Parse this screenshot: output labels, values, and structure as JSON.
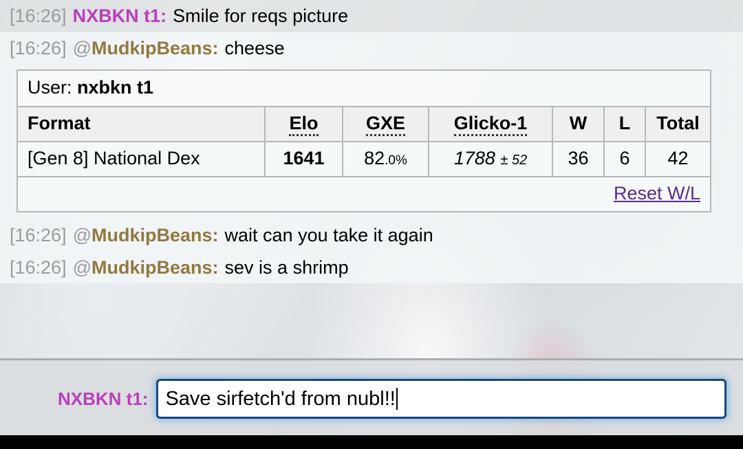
{
  "messages": [
    {
      "timestamp": "[16:26]",
      "at": "",
      "username": "NXBKN t1:",
      "color": "#bc3dbc",
      "text": "Smile for reqs picture"
    },
    {
      "timestamp": "[16:26]",
      "at": "@",
      "username": "MudkipBeans:",
      "color": "#94793f",
      "text": "cheese"
    }
  ],
  "messages_after": [
    {
      "timestamp": "[16:26]",
      "at": "@",
      "username": "MudkipBeans:",
      "color": "#94793f",
      "text": "wait can you take it again"
    },
    {
      "timestamp": "[16:26]",
      "at": "@",
      "username": "MudkipBeans:",
      "color": "#94793f",
      "text": "sev is a shrimp"
    }
  ],
  "rating_table": {
    "user_label": "User:",
    "user_name": "nxbkn t1",
    "headers": {
      "format": "Format",
      "elo": "Elo",
      "gxe": "GXE",
      "glicko": "Glicko-1",
      "w": "W",
      "l": "L",
      "total": "Total"
    },
    "row": {
      "format": "[Gen 8] National Dex",
      "elo": "1641",
      "gxe_main": "82",
      "gxe_suffix": ".0%",
      "glicko_main": "1788",
      "glicko_dev": "± 52",
      "w": "36",
      "l": "6",
      "total": "42"
    },
    "reset_link": "Reset W/L",
    "reset_link_color": "#5b2a8c"
  },
  "composer": {
    "username": "NXBKN t1:",
    "username_color": "#bc3dbc",
    "input_value": "Save sirfetch'd from nubl!!",
    "input_placeholder": ""
  }
}
